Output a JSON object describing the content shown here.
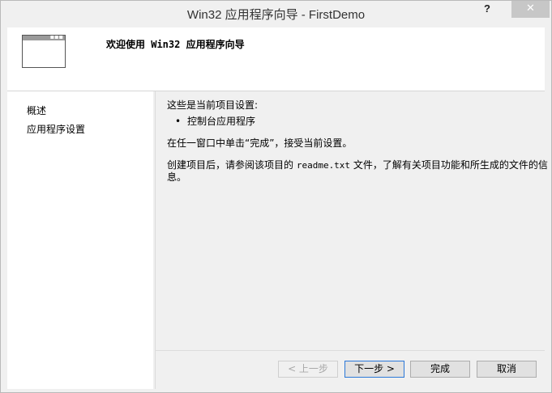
{
  "window": {
    "title": "Win32 应用程序向导 - FirstDemo",
    "help_label": "?",
    "close_label": "✕"
  },
  "header": {
    "title": "欢迎使用 Win32 应用程序向导",
    "icon": "window-icon"
  },
  "sidebar": {
    "items": [
      {
        "label": "概述"
      },
      {
        "label": "应用程序设置"
      }
    ]
  },
  "content": {
    "intro": "这些是当前项目设置:",
    "bullet": "•",
    "settings": [
      "控制台应用程序"
    ],
    "finish_hint": "在任一窗口中单击“完成”，接受当前设置。",
    "readme_before": "创建项目后，请参阅该项目的 ",
    "readme_file": "readme.txt",
    "readme_after": " 文件，了解有关项目功能和所生成的文件的信息。"
  },
  "buttons": {
    "prev": "< 上一步",
    "next": "下一步 >",
    "finish": "完成",
    "cancel": "取消"
  },
  "colors": {
    "close_button": "#c7c7c7",
    "default_button_border": "#2b78d8",
    "panel_background": "#ffffff",
    "dialog_background": "#f0f0f0"
  }
}
